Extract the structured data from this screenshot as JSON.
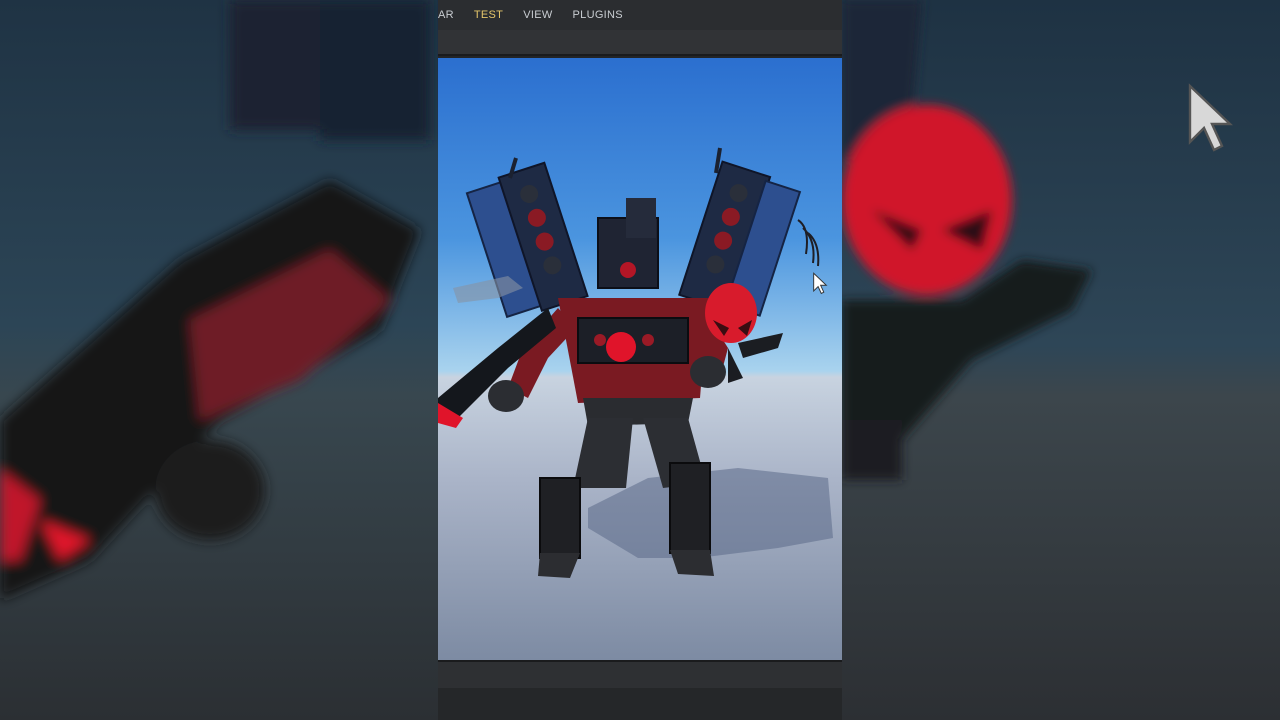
{
  "menu": {
    "items": [
      {
        "label": "AR",
        "active": false
      },
      {
        "label": "TEST",
        "active": true
      },
      {
        "label": "VIEW",
        "active": false
      },
      {
        "label": "PLUGINS",
        "active": false
      }
    ]
  },
  "colors": {
    "active_menu": "#e5c66a",
    "menu_text": "#c9cdd2",
    "accent_red": "#e0142a",
    "sky_top": "#2b6fcf",
    "ground": "#aab4c8"
  },
  "viewport": {
    "scene": "3d-character-model",
    "icons": [
      "cursor-icon"
    ]
  }
}
